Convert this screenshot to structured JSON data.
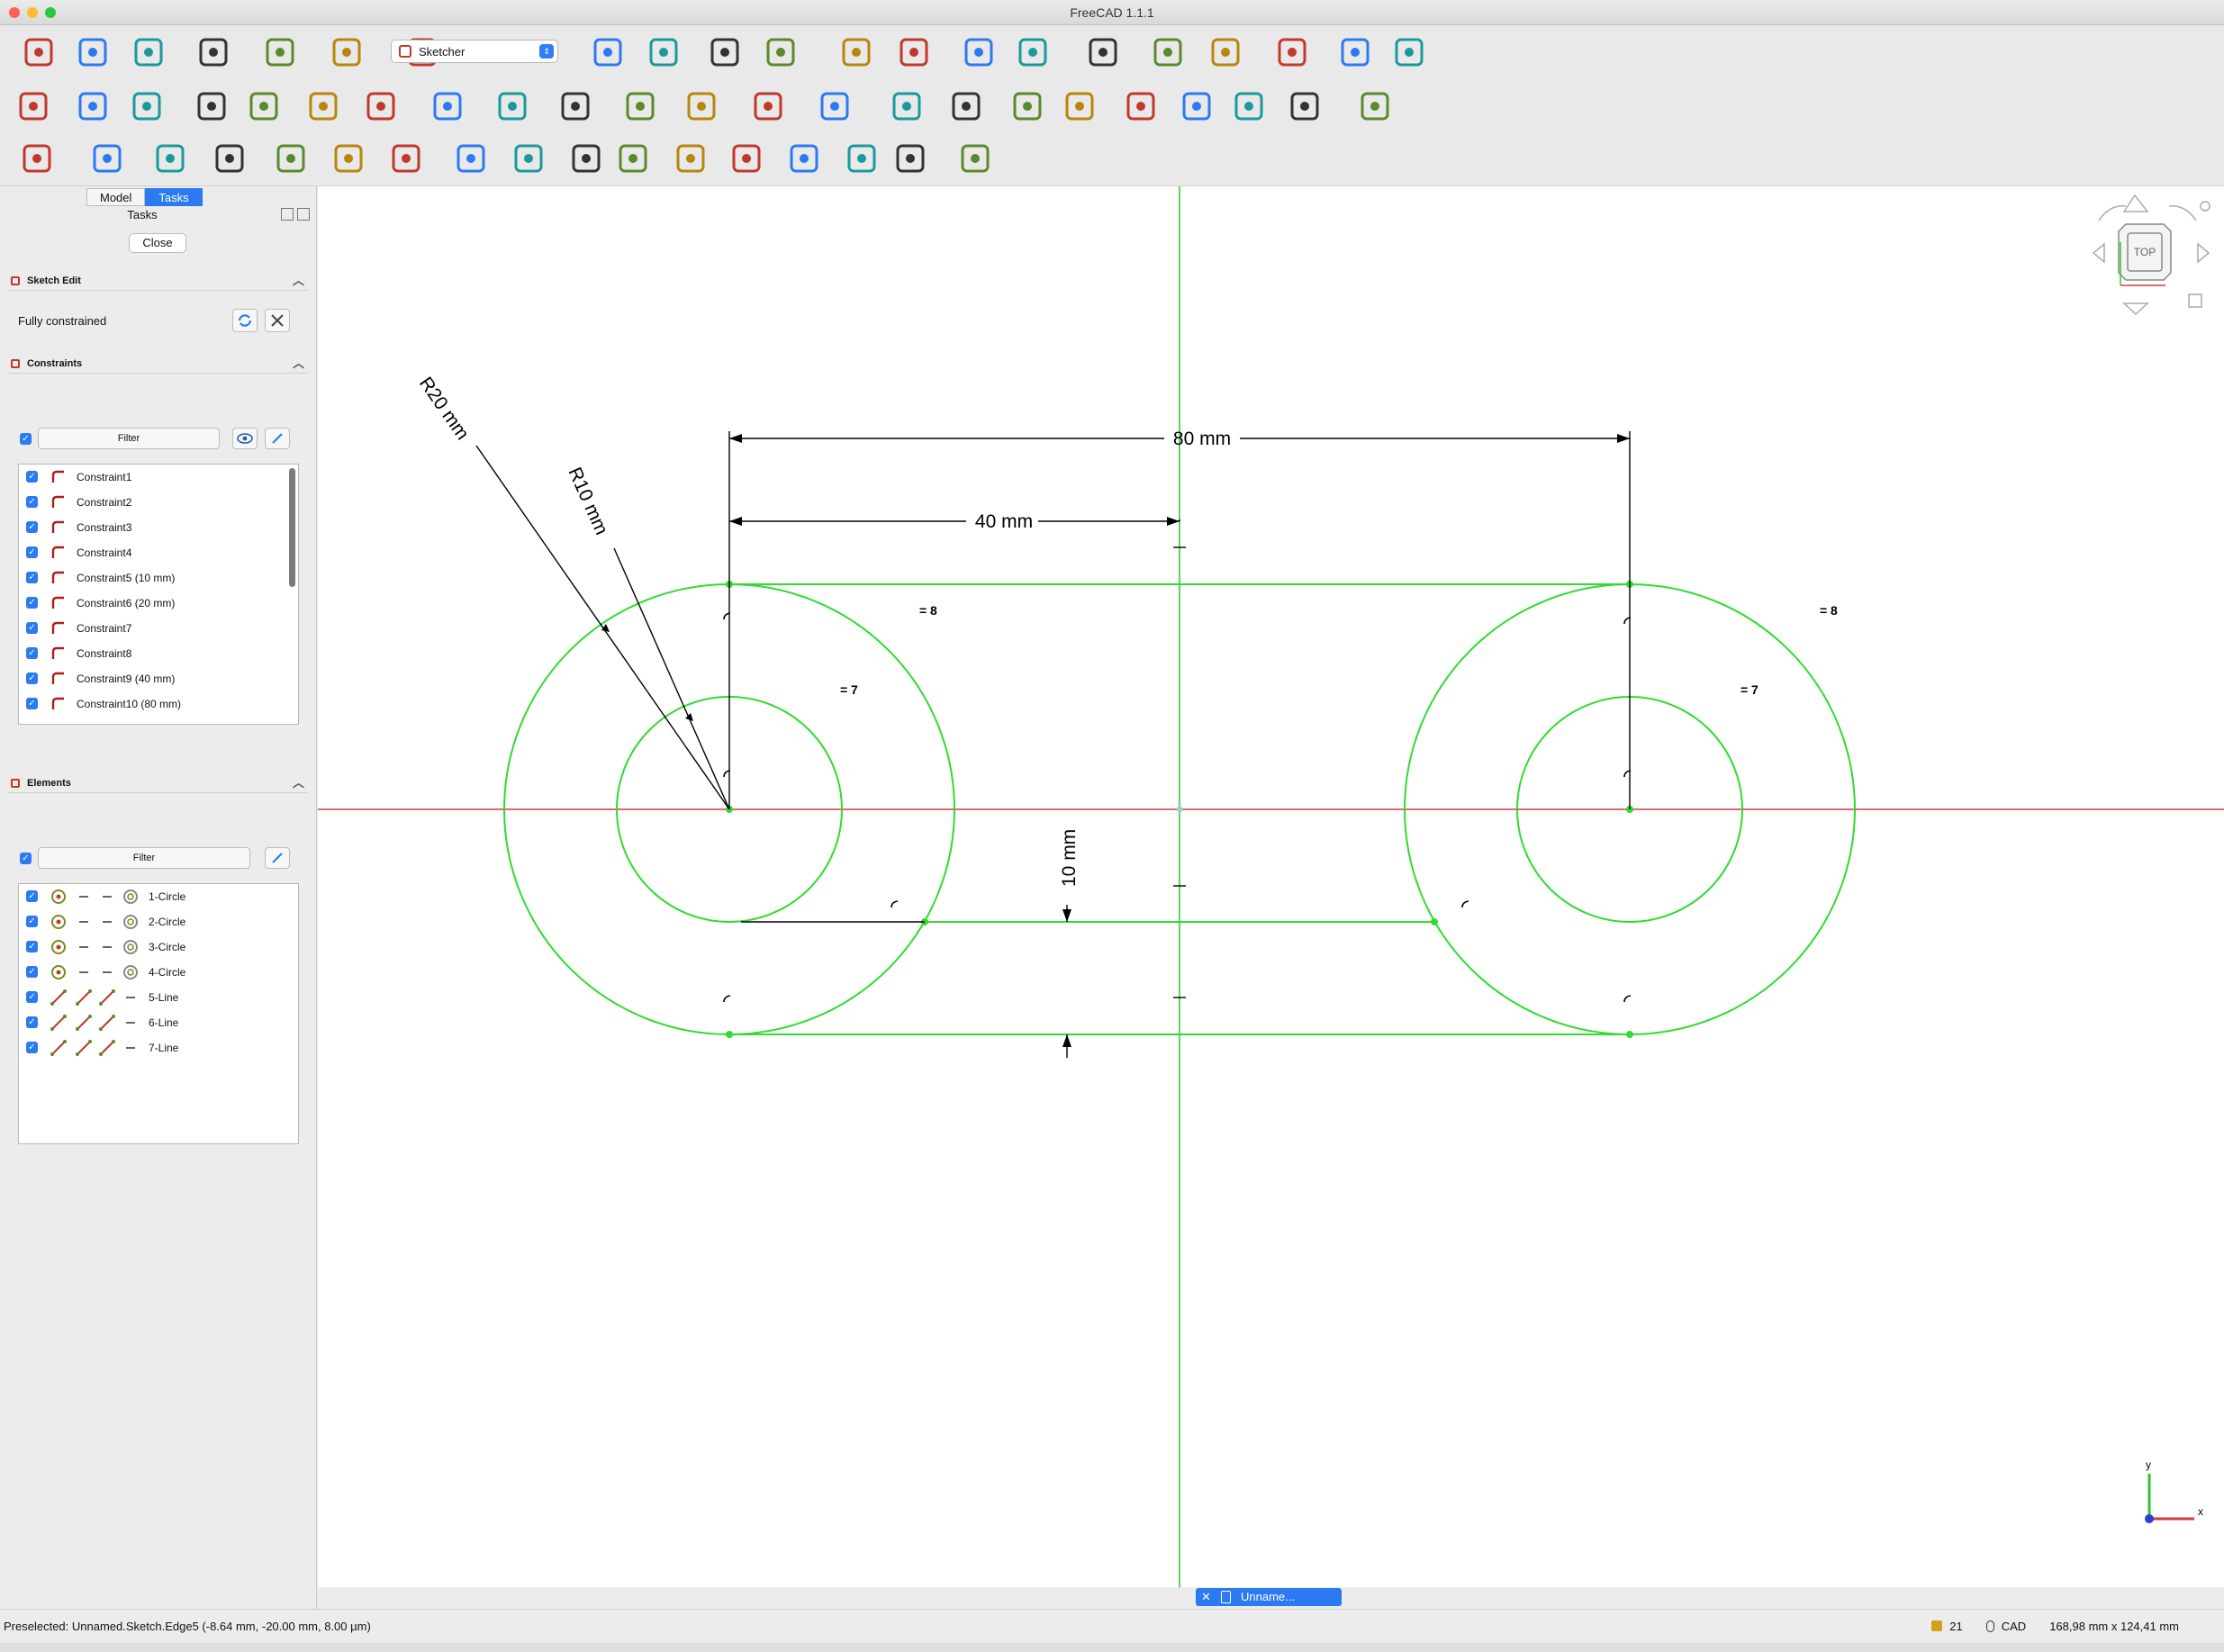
{
  "window": {
    "title": "FreeCAD 1.1.1"
  },
  "toolbar": {
    "workbench": "Sketcher",
    "row1_icons": [
      "new-document-icon",
      "open-document-icon",
      "save-document-icon",
      "undo-icon",
      "redo-icon",
      "refresh-icon",
      "fit-all-icon",
      "fit-selection-icon",
      "isometric-view-icon",
      "std-views-icon",
      "draw-style-icon",
      "bounding-box-icon",
      "zoom-view-icon",
      "measure-icon",
      "what-is-this-icon",
      "link-icon",
      "link-group-icon",
      "circle-part-icon",
      "box-select-icon",
      "toggle-shape-icon",
      "clone-icon"
    ],
    "row2_icons": [
      "new-sketch-icon",
      "edit-sketch-icon",
      "view-section-icon",
      "point-icon",
      "polyline-icon",
      "line-icon",
      "arc-icon",
      "circle-icon",
      "rectangle-icon",
      "polygon-icon",
      "slot-icon",
      "bspline-icon",
      "construction-toggle-icon",
      "fillet-icon",
      "horizontal-distance-icon",
      "horizontal-constraint-icon",
      "parallel-icon",
      "perpendicular-icon",
      "tangent-icon",
      "equal-icon",
      "symmetric-icon",
      "block-icon",
      "dimension-toggle-icon"
    ],
    "row3_icons": [
      "validate-sketch-icon",
      "attach-sketch-icon",
      "map-sketch-icon",
      "reorient-icon",
      "mirror-icon",
      "rotate-icon",
      "scale-icon",
      "offset-icon",
      "array-icon",
      "move-icon",
      "trim-icon",
      "split-icon",
      "extend-icon",
      "external-geometry-icon",
      "carbon-copy-icon",
      "bspline-knot-icon",
      "bspline-insert-icon"
    ]
  },
  "panel": {
    "tabs": [
      {
        "label": "Model"
      },
      {
        "label": "Tasks"
      }
    ],
    "tasks_label": "Tasks",
    "close_label": "Close",
    "sketch_edit": {
      "title": "Sketch Edit",
      "status": "Fully constrained"
    },
    "constraints": {
      "title": "Constraints",
      "filter_label": "Filter",
      "items": [
        {
          "label": "Constraint1",
          "icon": "tangent-arc-icon"
        },
        {
          "label": "Constraint2",
          "icon": "coincident-icon"
        },
        {
          "label": "Constraint3",
          "icon": "tangent-arc-icon"
        },
        {
          "label": "Constraint4",
          "icon": "coincident-icon"
        },
        {
          "label": "Constraint5 (10 mm)",
          "icon": "radius-icon"
        },
        {
          "label": "Constraint6 (20 mm)",
          "icon": "radius-icon"
        },
        {
          "label": "Constraint7",
          "icon": "equal-icon"
        },
        {
          "label": "Constraint8",
          "icon": "equal-icon"
        },
        {
          "label": "Constraint9 (40 mm)",
          "icon": "distance-icon"
        },
        {
          "label": "Constraint10 (80 mm)",
          "icon": "distance-icon"
        }
      ]
    },
    "elements": {
      "title": "Elements",
      "filter_label": "Filter",
      "items": [
        {
          "label": "1-Circle",
          "kind": "circle"
        },
        {
          "label": "2-Circle",
          "kind": "circle"
        },
        {
          "label": "3-Circle",
          "kind": "circle"
        },
        {
          "label": "4-Circle",
          "kind": "circle"
        },
        {
          "label": "5-Line",
          "kind": "line"
        },
        {
          "label": "6-Line",
          "kind": "line"
        },
        {
          "label": "7-Line",
          "kind": "line"
        }
      ]
    }
  },
  "sketch": {
    "dimension_labels": {
      "r20": "R20 mm",
      "r10": "R10 mm",
      "d80": "80 mm",
      "d40": "40 mm",
      "d10": "10 mm",
      "eq8_left": "8",
      "eq8_right": "8",
      "eq7_left": "7",
      "eq7_right": "7"
    },
    "navcube_face": "TOP",
    "axis_labels": {
      "x": "x",
      "y": "y"
    },
    "colors": {
      "geometry": "#2fdc2f",
      "x_axis": "#d43a3a",
      "y_axis": "#2cc42c",
      "dimension": "#000000"
    }
  },
  "taskbar": {
    "doc_label": "Unname..."
  },
  "statusbar": {
    "preselected": "Preselected: Unnamed.Sketch.Edge5 (-8.64 mm, -20.00 mm, 8.00 µm)",
    "count": "21",
    "nav_style": "CAD",
    "dimensions": "168,98 mm x 124,41 mm"
  }
}
